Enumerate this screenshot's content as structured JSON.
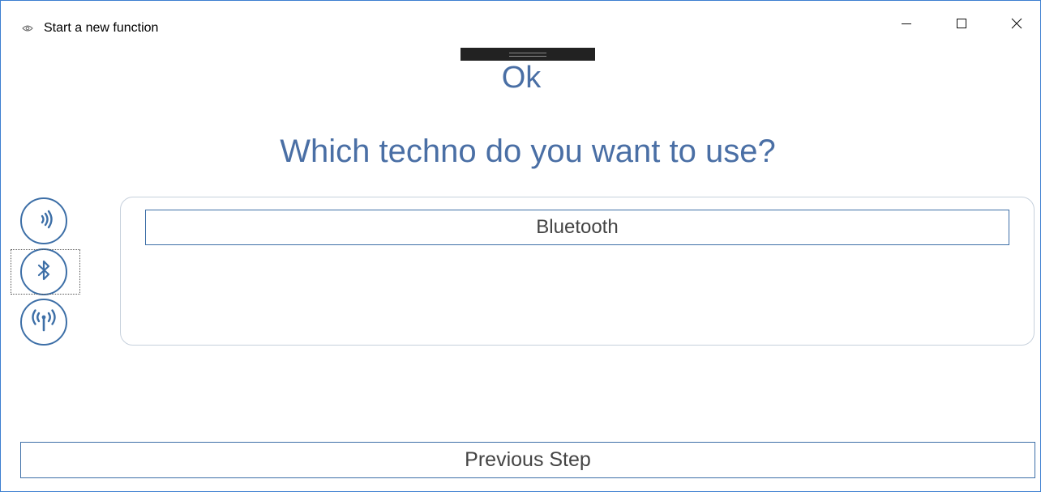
{
  "window": {
    "title": "Start a new function",
    "app_icon": "eye-icon",
    "controls": [
      "minimize-icon",
      "maximize-icon",
      "close-icon"
    ]
  },
  "status": {
    "text": "Ok"
  },
  "question": {
    "text": "Which techno do you want to use?"
  },
  "techno_icons": [
    {
      "name": "nfc-icon"
    },
    {
      "name": "bluetooth-icon",
      "focused": true
    },
    {
      "name": "radio-antenna-icon"
    }
  ],
  "options": [
    {
      "label": "Bluetooth"
    }
  ],
  "navigation": {
    "previous_label": "Previous Step"
  },
  "colors": {
    "accent": "#3d6fa7",
    "text_blue": "#4a6fa5",
    "window_border": "#3c7fd1"
  }
}
